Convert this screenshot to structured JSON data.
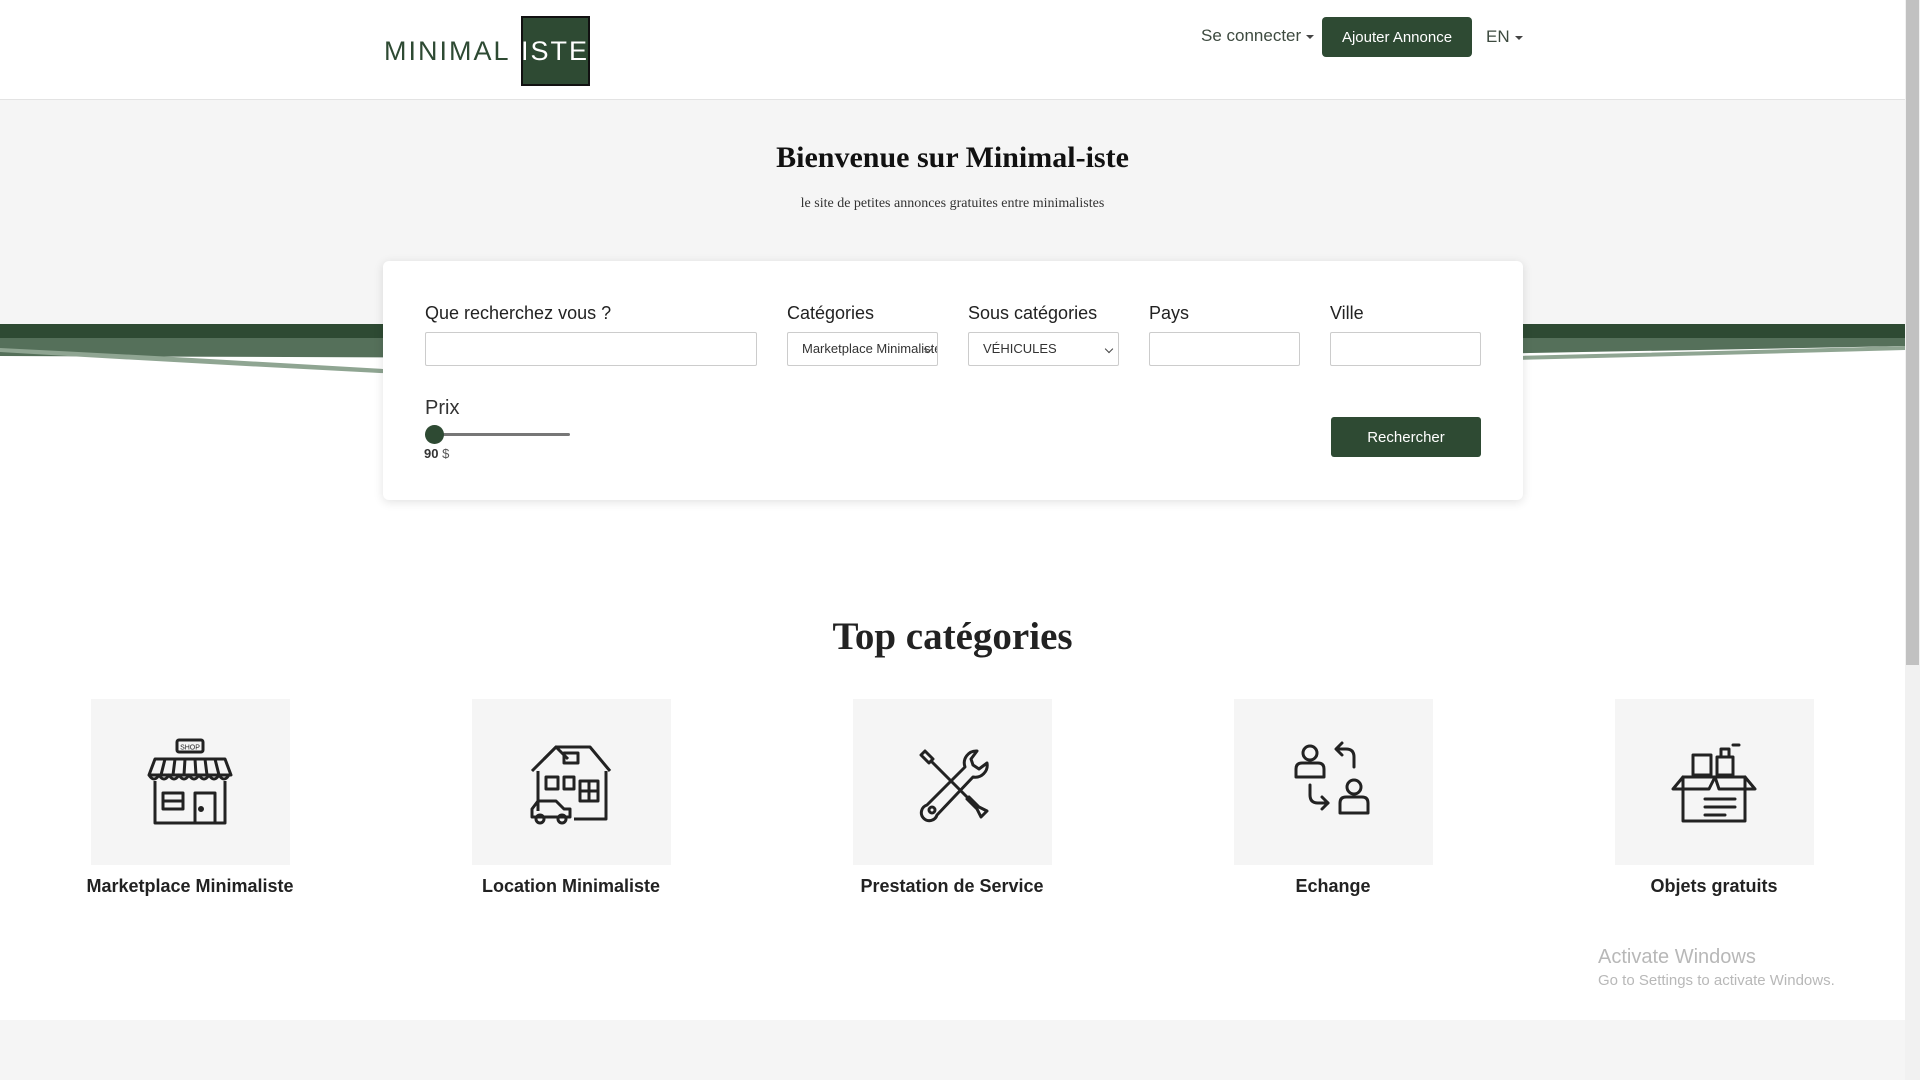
{
  "header": {
    "logo_left": "MINIMAL",
    "logo_right": "ISTE",
    "login_label": "Se connecter",
    "add_label": "Ajouter Annonce",
    "lang_label": "EN"
  },
  "hero": {
    "title": "Bienvenue sur Minimal-iste",
    "subtitle": "le site de petites annonces gratuites entre minimalistes"
  },
  "search": {
    "query_label": "Que recherchez vous ?",
    "query_value": "",
    "category_label": "Catégories",
    "category_value": "Marketplace Minimaliste",
    "subcategory_label": "Sous catégories",
    "subcategory_value": "VÉHICULES",
    "country_label": "Pays",
    "country_value": "",
    "city_label": "Ville",
    "city_value": "",
    "price_label": "Prix",
    "price_value": "90",
    "price_currency": "$",
    "price_slider_fraction": 0,
    "submit_label": "Rechercher"
  },
  "categories": {
    "title": "Top catégories",
    "items": [
      {
        "label": "Marketplace Minimaliste",
        "icon": "shop-icon",
        "icon_text": "SHOP"
      },
      {
        "label": "Location Minimaliste",
        "icon": "house-car-icon"
      },
      {
        "label": "Prestation de Service",
        "icon": "tools-icon"
      },
      {
        "label": "Echange",
        "icon": "exchange-icon"
      },
      {
        "label": "Objets gratuits",
        "icon": "box-icon"
      }
    ]
  },
  "watermark": {
    "line1": "Activate Windows",
    "line2": "Go to Settings to activate Windows."
  },
  "colors": {
    "brand": "#2e4a33",
    "wave_light": "#8fa592",
    "wave_mid": "#55705a"
  }
}
